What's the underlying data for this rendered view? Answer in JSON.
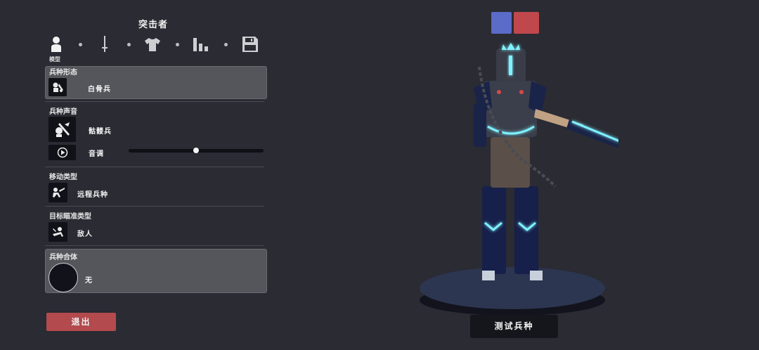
{
  "header": {
    "title": "突击者"
  },
  "tabs": {
    "active_label": "模型",
    "items": [
      {
        "icon": "person-icon"
      },
      {
        "icon": "sword-icon"
      },
      {
        "icon": "shirt-icon"
      },
      {
        "icon": "stats-icon"
      },
      {
        "icon": "save-icon"
      }
    ]
  },
  "sections": {
    "unit_form": {
      "title": "兵种形态",
      "value": "白骨兵",
      "icon": "skeleton-icon"
    },
    "unit_voice": {
      "title": "兵种声音",
      "value": "骷髅兵",
      "icon": "skeleton-voice-icon",
      "pitch_label": "音调",
      "pitch_level": 0.5
    },
    "move_type": {
      "title": "移动类型",
      "value": "远程兵种",
      "icon": "ranged-unit-icon"
    },
    "target_type": {
      "title": "目标瞄准类型",
      "value": "敌人",
      "icon": "enemy-target-icon"
    },
    "combine": {
      "title": "兵种合体",
      "value": "无"
    }
  },
  "buttons": {
    "exit": "退出",
    "test": "测试兵种"
  },
  "team_colors": {
    "blue": "#5a6bc8",
    "red": "#c0474b"
  }
}
